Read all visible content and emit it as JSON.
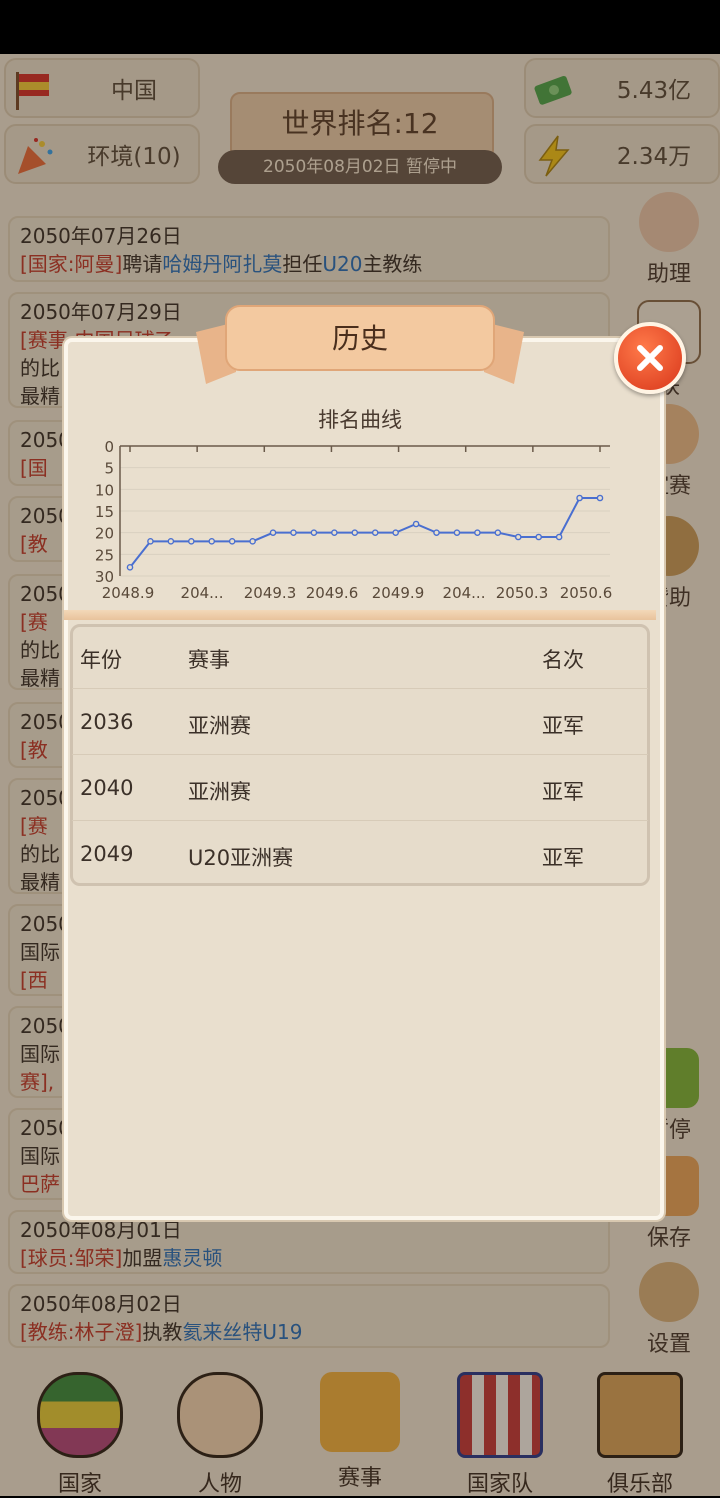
{
  "header": {
    "country": "中国",
    "environment": "环境(10)",
    "world_rank": "世界排名:12",
    "date_status": "2050年08月02日  暂停中",
    "money": "5.43亿",
    "energy": "2.34万"
  },
  "feed": [
    {
      "date": "2050年07月26日",
      "tag": "[国家:阿曼]",
      "t1": "聘请",
      "name": "哈姆丹阿扎莫",
      "t2": "担任",
      "team": "U20",
      "t3": "主教练"
    },
    {
      "date": "2050年07月29日",
      "tag": "[赛事:中国足球乙",
      "text": "的比",
      "text2": "最精"
    },
    {
      "date": "2050",
      "tag": "[国"
    },
    {
      "date": "2050",
      "tag": "[教"
    },
    {
      "date": "2050",
      "tag": "[赛",
      "text": "的比",
      "text2": "最精"
    },
    {
      "date": "2050",
      "tag": "[教"
    },
    {
      "date": "2050",
      "tag": "[赛",
      "text": "的比",
      "text2": "最精"
    },
    {
      "date": "2050",
      "text": "国际",
      "tag": "[西"
    },
    {
      "date": "2050",
      "text": "国际",
      "tag": "赛],"
    },
    {
      "date": "2050",
      "text": "国际",
      "tag": "巴萨"
    },
    {
      "date": "2050年08月01日",
      "tag": "[球员:邹荣]",
      "t1": "加盟",
      "club": "惠灵顿"
    },
    {
      "date": "2050年08月02日",
      "tag": "[教练:林子澄]",
      "t1": "执教",
      "club": "氦来丝特U19"
    }
  ],
  "sidebar": {
    "assistant": "助理",
    "league": "联",
    "friendly": "谊赛",
    "sponsor": "赞助",
    "pause": "暂停",
    "save": "保存",
    "settings": "设置"
  },
  "nav": [
    "国家",
    "人物",
    "赛事",
    "国家队",
    "俱乐部"
  ],
  "modal": {
    "title": "历史",
    "chart_title": "排名曲线",
    "table_headers": {
      "year": "年份",
      "event": "赛事",
      "rank": "名次"
    },
    "rows": [
      {
        "year": "2036",
        "event": "亚洲赛",
        "rank": "亚军"
      },
      {
        "year": "2040",
        "event": "亚洲赛",
        "rank": "亚军"
      },
      {
        "year": "2049",
        "event": "U20亚洲赛",
        "rank": "亚军"
      }
    ]
  },
  "chart_data": {
    "type": "line",
    "title": "排名曲线",
    "y_ticks": [
      "0",
      "5",
      "10",
      "15",
      "20",
      "25",
      "30"
    ],
    "ylim": [
      0,
      30
    ],
    "y_reversed": true,
    "x_tick_labels": [
      "2048.9",
      "204...",
      "2049.3",
      "2049.6",
      "2049.9",
      "204...",
      "2050.3",
      "2050.6"
    ],
    "series": [
      {
        "values": [
          28,
          22,
          22,
          22,
          22,
          22,
          22,
          20,
          20,
          20,
          20,
          20,
          20,
          20,
          18,
          20,
          20,
          20,
          20,
          21,
          21,
          21,
          12,
          12
        ]
      }
    ],
    "line_color": "#4a6fd0",
    "grid": true
  }
}
